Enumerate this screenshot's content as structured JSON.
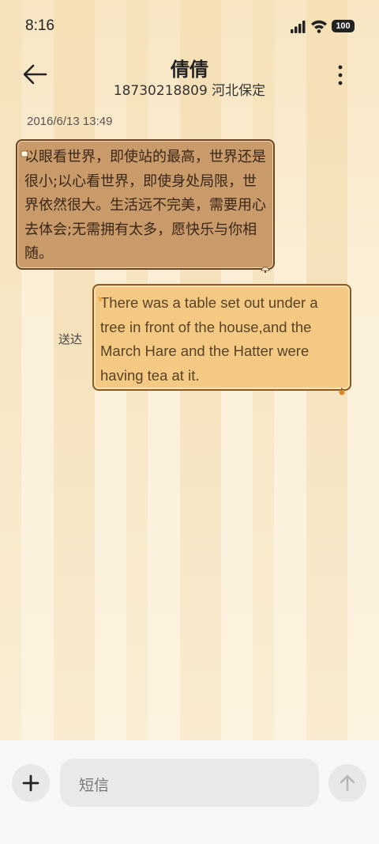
{
  "status_bar": {
    "time": "8:16",
    "battery": "100",
    "signal_icon": "signal-icon",
    "wifi_icon": "wifi-icon"
  },
  "header": {
    "contact_name": "倩倩",
    "contact_info": "18730218809 河北保定",
    "back_icon": "arrow-left-icon",
    "more_icon": "more-vertical-icon"
  },
  "conversation": {
    "timestamp": "2016/6/13 13:49",
    "messages": [
      {
        "direction": "incoming",
        "text": "以眼看世界，即使站的最高，世界还是很小;以心看世界，即使身处局限，世界依然很大。生活远不完美，需要用心去体会;无需拥有太多，愿快乐与你相随。"
      },
      {
        "direction": "outgoing",
        "text": "There was a table set out under a tree in front of the house,and the March Hare and the Hatter were having tea at it.",
        "status": "送达"
      }
    ]
  },
  "composer": {
    "placeholder": "短信",
    "add_icon": "plus-icon",
    "send_icon": "arrow-up-icon"
  },
  "colors": {
    "incoming_bubble": "#c99b6b",
    "outgoing_bubble": "#f3c983",
    "background_stripe": "#f7e6c4"
  }
}
